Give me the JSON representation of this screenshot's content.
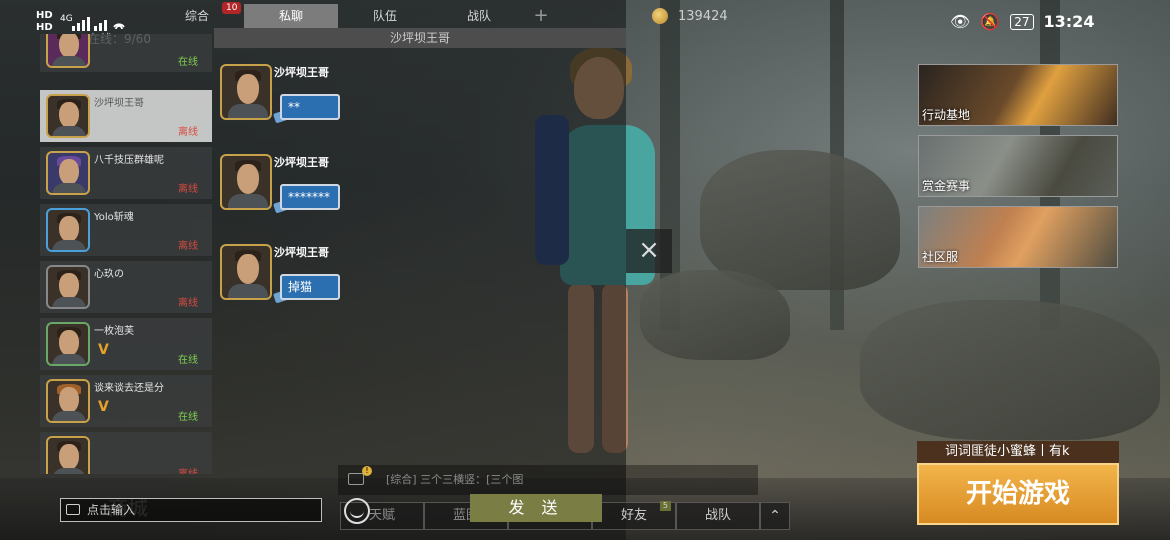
{
  "status_bar": {
    "hd1": "HD",
    "hd2": "HD",
    "network": "4G",
    "battery": "27",
    "time": "13:24"
  },
  "currency": {
    "amount": "139424"
  },
  "chat": {
    "tabs": [
      {
        "label": "综合",
        "badge": "10"
      },
      {
        "label": "私聊"
      },
      {
        "label": "队伍"
      },
      {
        "label": "战队"
      }
    ],
    "conversation_title": "沙坪坝王哥",
    "online_count": "在线：9/60",
    "friends": [
      {
        "name": "",
        "status": "在线"
      },
      {
        "name": "沙坪坝王哥",
        "status": "离线"
      },
      {
        "name": "八千技压群雄呢",
        "status": "离线"
      },
      {
        "name": "Yolo斩魂",
        "status": "离线"
      },
      {
        "name": "心玖の",
        "status": "离线"
      },
      {
        "name": "一枚泡芙",
        "status": "在线"
      },
      {
        "name": "谈来谈去还是分",
        "status": "在线"
      },
      {
        "name": "",
        "status": "离线"
      }
    ],
    "messages": [
      {
        "sender": "沙坪坝王哥",
        "text": "**"
      },
      {
        "sender": "沙坪坝王哥",
        "text": "*******"
      },
      {
        "sender": "沙坪坝王哥",
        "text": "掉猫"
      }
    ],
    "input_placeholder": "点击输入",
    "send_label": "发 送",
    "notice_text": "[综合] 三个三横竖：[三个图",
    "notice_badge": "!",
    "shop_label": "商城"
  },
  "bottom_nav": [
    {
      "label": "天赋"
    },
    {
      "label": "蓝图"
    },
    {
      "label": ""
    },
    {
      "label": "好友",
      "badge": "5"
    },
    {
      "label": "战队"
    }
  ],
  "side_modes": [
    {
      "label": "行动基地"
    },
    {
      "label": "赏金赛事"
    },
    {
      "label": "社区服"
    }
  ],
  "player_strip": "词词匪徒小蜜蜂丨有k",
  "start_button": "开始游戏",
  "colors": {
    "accent_orange": "#e39a2e",
    "send_green": "#7a7e45",
    "bubble_blue": "#2b6fb0",
    "online_green": "#7fd04f",
    "offline_red": "#d84b3f"
  }
}
